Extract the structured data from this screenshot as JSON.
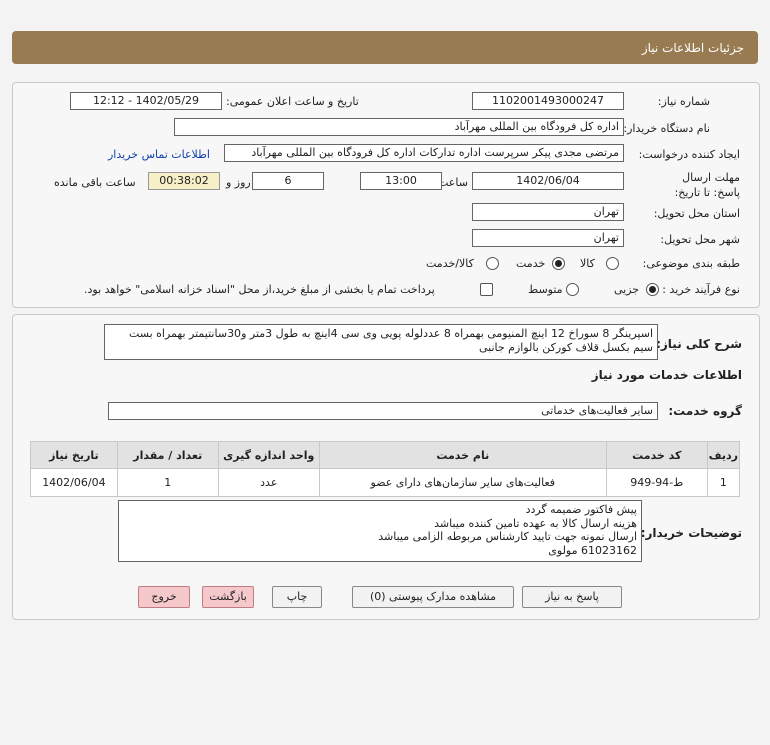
{
  "header": {
    "title": "جزئیات اطلاعات نیاز"
  },
  "form": {
    "need_number_label": "شماره نیاز:",
    "need_number": "1102001493000247",
    "announce_label": "تاریخ و ساعت اعلان عمومی:",
    "announce_value": "1402/05/29 - 12:12",
    "buyer_org_label": "نام دستگاه خریدار:",
    "buyer_org": "اداره کل فرودگاه بین المللی مهرآباد",
    "requester_label": "ایجاد کننده درخواست:",
    "requester": "مرتضی مجدی پیکر سرپرست اداره تدارکات  اداره کل فرودگاه بین المللی مهرآباد",
    "contact_link": "اطلاعات تماس خریدار",
    "deadline_label": "مهلت ارسال پاسخ: تا تاریخ:",
    "deadline_date": "1402/06/04",
    "hour_label": "ساعت",
    "deadline_time": "13:00",
    "days_value": "6",
    "days_label": "روز و",
    "remaining_value": "00:38:02",
    "remaining_label": "ساعت باقی مانده",
    "province_label": "استان محل تحویل:",
    "province": "تهران",
    "city_label": "شهر محل تحویل:",
    "city": "تهران",
    "category_label": "طبقه بندی موضوعی:",
    "category_options": [
      "کالا",
      "خدمت",
      "کالا/خدمت"
    ],
    "category_selected": "خدمت",
    "process_label": "نوع فرآیند خرید :",
    "process_options": [
      "جزیی",
      "متوسط"
    ],
    "process_selected": "جزیی",
    "treasury_note": "پرداخت تمام یا بخشی از مبلغ خرید،از محل \"اسناد خزانه اسلامی\" خواهد بود."
  },
  "details": {
    "description_label": "شرح کلی نیاز:",
    "description": "اسپرینگر 8 سوراخ 12 اینچ المنیومی بهمراه 8 عددلوله پویی وی سی 4اینچ به طول 3متر و30سانتیمتر بهمراه بست سیم بکسل قلاف کورکن بالوازم جانبی",
    "services_title": "اطلاعات خدمات مورد نیاز",
    "service_group_label": "گروه خدمت:",
    "service_group": "سایر فعالیت‌های خدماتی",
    "table": {
      "headers": [
        "ردیف",
        "کد خدمت",
        "نام خدمت",
        "واحد اندازه گیری",
        "تعداد / مقدار",
        "تاریخ نیاز"
      ],
      "rows": [
        [
          "1",
          "ط-94-949",
          "فعالیت‌های سایر سازمان‌های دارای عضو",
          "عدد",
          "1",
          "1402/06/04"
        ]
      ]
    },
    "buyer_notes_label": "توضیحات خریدار:",
    "buyer_notes": [
      "پیش فاکتور ضمیمه گردد",
      "هزینه ارسال کالا به عهده تامین کننده میباشد",
      "ارسال نمونه جهت تایید کارشناس مربوطه الزامی میباشد",
      "61023162 مولوی"
    ]
  },
  "buttons": {
    "reply": "پاسخ به نیاز",
    "attachments": "مشاهده مدارک پیوستی (0)",
    "print": "چاپ",
    "back": "بازگشت",
    "exit": "خروج"
  }
}
